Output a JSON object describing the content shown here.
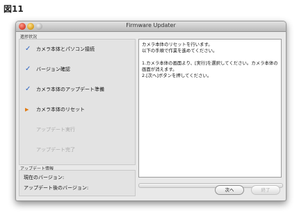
{
  "figure_label": "図11",
  "window": {
    "title": "Firmware Updater"
  },
  "progress_group": {
    "label": "進捗状況"
  },
  "steps": [
    {
      "label": "カメラ本体とパソコン接続",
      "state": "done"
    },
    {
      "label": "バージョン確認",
      "state": "done"
    },
    {
      "label": "カメラ本体のアップデート準備",
      "state": "done"
    },
    {
      "label": "カメラ本体のリセット",
      "state": "current"
    },
    {
      "label": "アップデート実行",
      "state": "pending"
    },
    {
      "label": "アップデート完了",
      "state": "pending"
    }
  ],
  "message": "カメラ本体のリセットを行います。\n以下の手順で作業を進めてください。\n\n1.カメラ本体の画面より、[実行]を選択してください。カメラ本体の画面が消えます。\n2.[次へ]ボタンを押してください。",
  "update_info": {
    "label": "アップデート情報",
    "current_version_label": "現在のバージョン:",
    "post_update_version_label": "アップデート後のバージョン:"
  },
  "buttons": {
    "next": "次へ",
    "finish": "終了"
  },
  "colors": {
    "check": "#2b63c0",
    "current_arrow": "#e07a12"
  }
}
